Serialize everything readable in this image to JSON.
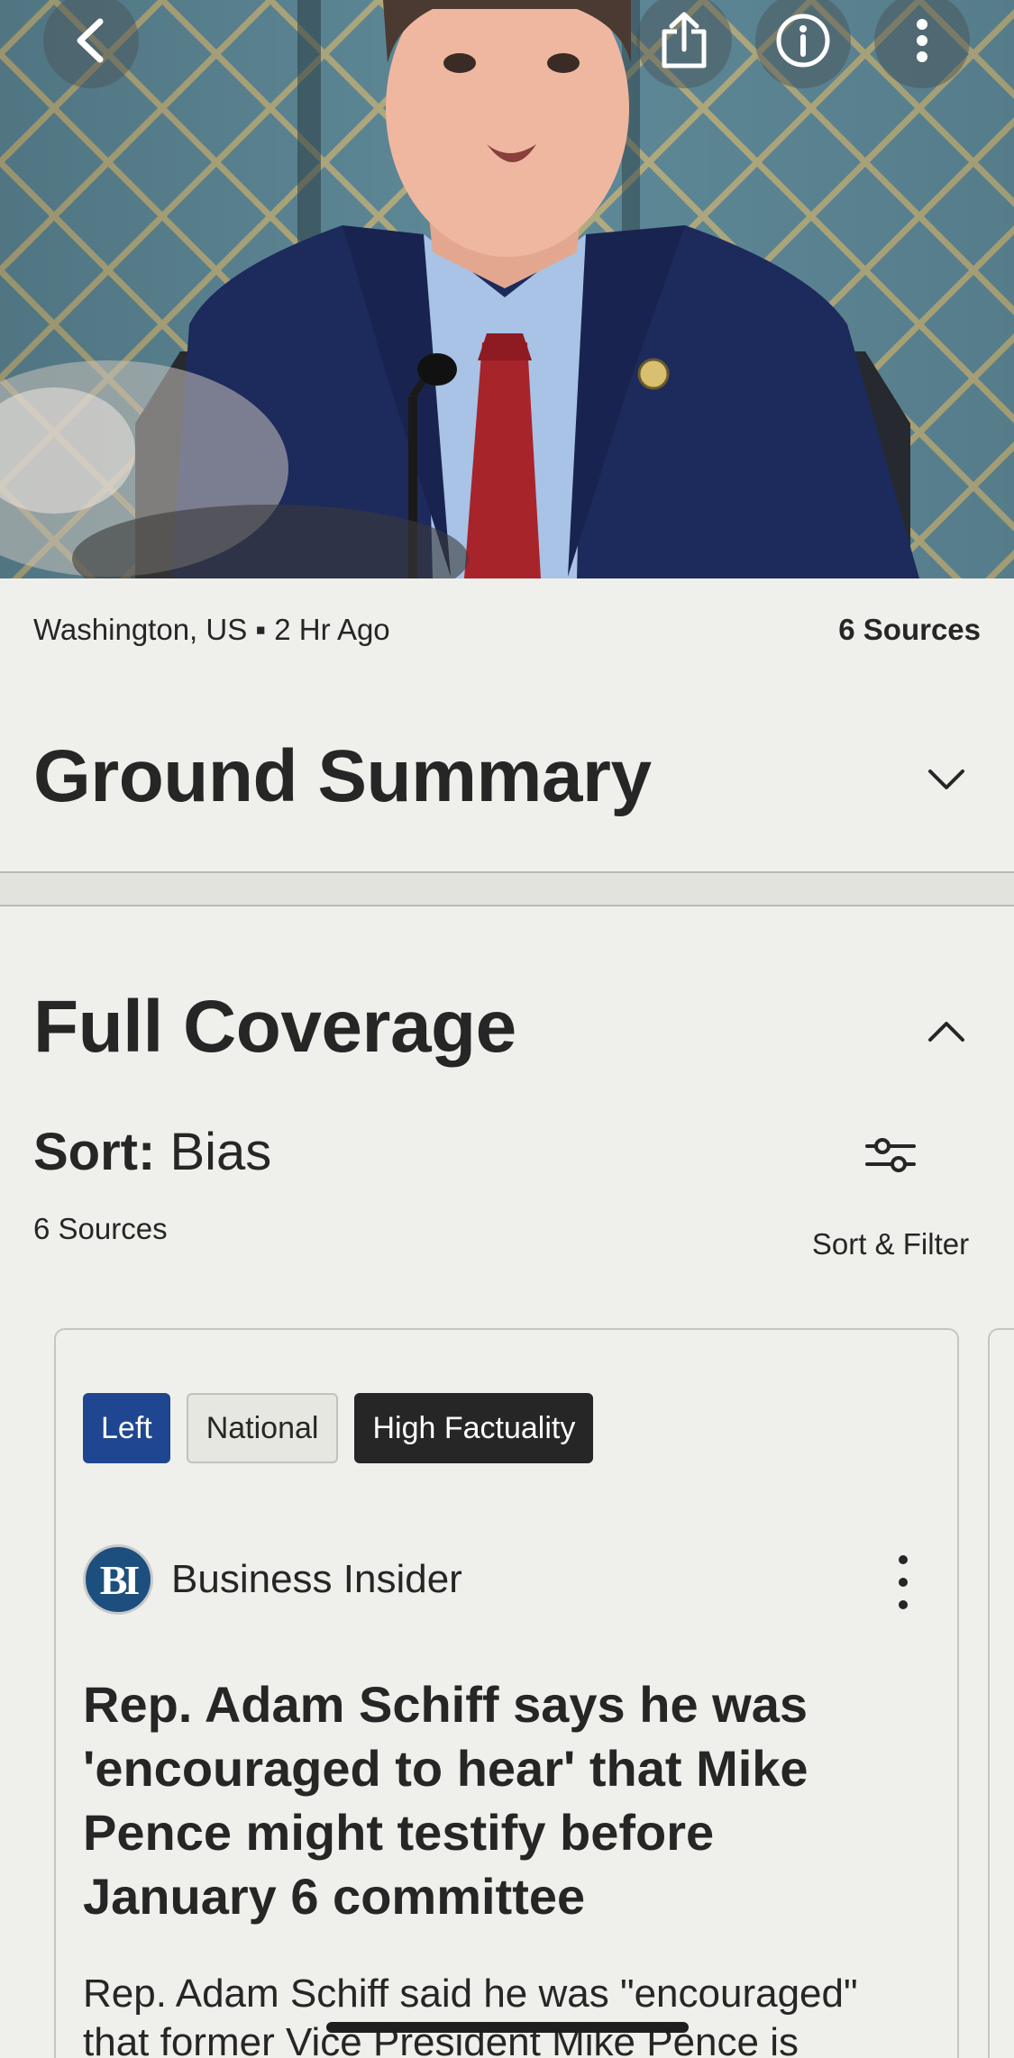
{
  "hero": {
    "back_icon": "chevron-left-icon",
    "share_icon": "share-icon",
    "info_icon": "info-icon",
    "more_icon": "more-vertical-icon"
  },
  "meta": {
    "location_time": "Washington, US ▪ 2 Hr Ago",
    "sources": "6 Sources"
  },
  "ground_summary": {
    "title": "Ground Summary",
    "chevron": "chevron-down-icon"
  },
  "full_coverage": {
    "title": "Full Coverage",
    "chevron": "chevron-up-icon",
    "sort_label": "Sort:",
    "sort_value": " Bias",
    "source_count": "6 Sources",
    "filter_label": "Sort & Filter",
    "filter_icon": "sliders-icon"
  },
  "article": {
    "tags": [
      "Left",
      "National",
      "High Factuality"
    ],
    "publisher_logo": "BI",
    "publisher": "Business Insider",
    "headline": "Rep. Adam Schiff says he was 'encouraged to hear' that Mike Pence might testify before January 6 committee",
    "summary": "Rep. Adam Schiff said he was \"encouraged\" that former Vice President Mike Pence is"
  },
  "colors": {
    "background": "#efefeb",
    "left_tag": "#1f4690",
    "fact_tag": "#262626",
    "text": "#262626"
  }
}
